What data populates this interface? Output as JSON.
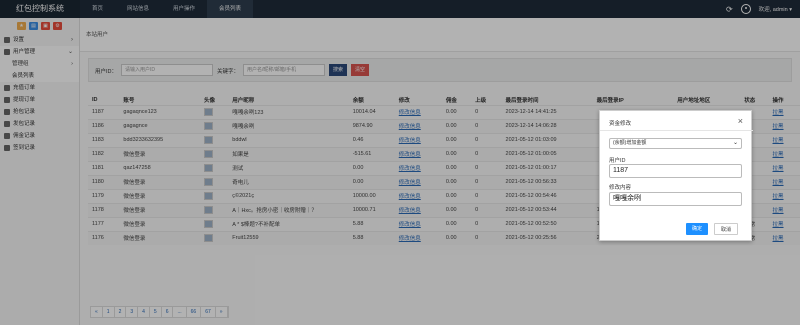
{
  "app": {
    "brand": "红包控制系统"
  },
  "nav": [
    "首页",
    "网站信息",
    "用户操作",
    "会员列表"
  ],
  "user": {
    "greeting": "欢迎, admin ▾"
  },
  "sidebar": {
    "items": [
      {
        "label": "设置",
        "arrow": "›"
      },
      {
        "label": "用户管理",
        "arrow": "⌄"
      },
      {
        "sub": "管理组",
        "arrow": "›"
      },
      {
        "sub": "会员列表"
      },
      {
        "label": "充值订单"
      },
      {
        "label": "提现订单"
      },
      {
        "label": "抢包记录"
      },
      {
        "label": "发包记录"
      },
      {
        "label": "佣金记录"
      },
      {
        "label": "签到记录"
      }
    ]
  },
  "tab": {
    "label": "本站用户"
  },
  "search": {
    "uid_label": "用户ID：",
    "uid_placeholder": "请输入用户ID",
    "kw_label": "关键字：",
    "kw_placeholder": "用户名/昵称/邮箱/手机",
    "search_btn": "搜索",
    "reset_btn": "清空"
  },
  "table": {
    "headers": [
      "ID",
      "账号",
      "头像",
      "用户昵称",
      "余额",
      "修改",
      "佣金",
      "上级",
      "最后登录时间",
      "最后登录IP",
      "用户地址地区",
      "状态",
      "操作"
    ],
    "rows": [
      [
        "1187",
        "gagaqnce123",
        "",
        "嘎嘎余咧123",
        "10014.04",
        "修改信息",
        "0.00",
        "0",
        "2023-12-14 14:41:25",
        "",
        "",
        "",
        "拉黑"
      ],
      [
        "1186",
        "gagagnce",
        "",
        "嘎嘎余咧",
        "9874.90",
        "修改信息",
        "0.00",
        "0",
        "2023-12-14 14:06:28",
        "",
        "",
        "",
        "拉黑"
      ],
      [
        "1183",
        "bdd3233632395",
        "",
        "bddwl",
        "0.46",
        "修改信息",
        "0.00",
        "0",
        "2021-05-12 01:03:09",
        "",
        "",
        "",
        "拉黑"
      ],
      [
        "1182",
        "微信登录",
        "",
        "如果是",
        "-515.61",
        "修改信息",
        "0.00",
        "0",
        "2021-05-12 01:00:05",
        "",
        "",
        "",
        "拉黑"
      ],
      [
        "1181",
        "qaz147258",
        "",
        "测试",
        "0.00",
        "修改信息",
        "0.00",
        "0",
        "2021-05-12 01:00:17",
        "",
        "",
        "",
        "拉黑"
      ],
      [
        "1180",
        "微信登录",
        "",
        "奇电儿",
        "0.00",
        "修改信息",
        "0.00",
        "0",
        "2021-05-12 00:56:33",
        "",
        "",
        "",
        "拉黑"
      ],
      [
        "1179",
        "微信登录",
        "",
        "ç©2021ç",
        "10000.00",
        "修改信息",
        "0.00",
        "0",
        "2021-05-12 00:54:46",
        "",
        "",
        "",
        "拉黑"
      ],
      [
        "1178",
        "微信登录",
        "",
        "A｜Hxc。抢房小密｜收房附赠｜？",
        "10000.71",
        "修改信息",
        "0.00",
        "0",
        "2021-05-12 00:53:44",
        "119.120.219.225",
        "",
        "",
        "拉黑"
      ],
      [
        "1177",
        "微信登录",
        "",
        "A * $棒题?不补配单",
        "5.88",
        "修改信息",
        "0.00",
        "0",
        "2021-05-12 00:52:50",
        "183.38.133.95",
        "",
        "正常",
        "拉黑"
      ],
      [
        "1176",
        "微信登录",
        "",
        "Fruit12559",
        "5.88",
        "修改信息",
        "0.00",
        "0",
        "2021-05-12 00:25:56",
        "223.88.51.60",
        "",
        "正常",
        "拉黑"
      ]
    ]
  },
  "pager": [
    "«",
    "1",
    "2",
    "3",
    "4",
    "5",
    "6",
    "...",
    "66",
    "67",
    "»"
  ],
  "modal": {
    "title": "资金修改",
    "close": "×",
    "select_value": "(余额)增加金额",
    "uid_label": "用户ID",
    "uid_value": "1187",
    "content_label": "修改内容",
    "content_value": "嘎嘎余咧",
    "confirm": "确定",
    "cancel": "取消"
  },
  "colors": {
    "topbar": "#1f2c3a",
    "search_btn": "#2b4a7a",
    "reset_btn": "#d9534f",
    "confirm": "#1e90ff",
    "link": "#2a6ab8"
  }
}
